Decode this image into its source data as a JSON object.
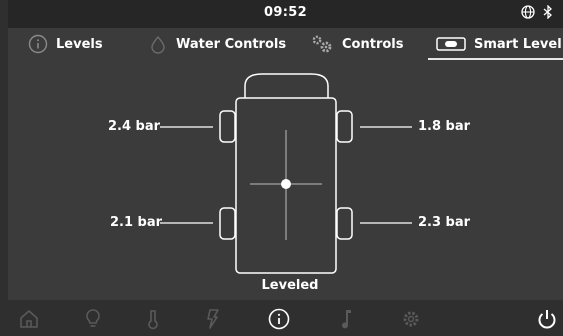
{
  "status": {
    "time": "09:52",
    "icons": [
      "globe-icon",
      "bluetooth-icon"
    ]
  },
  "tabs": [
    {
      "label": "Levels",
      "icon": "info-icon",
      "active": false
    },
    {
      "label": "Water Controls",
      "icon": "water-drop-icon",
      "active": false
    },
    {
      "label": "Controls",
      "icon": "gears-icon",
      "active": false
    },
    {
      "label": "Smart Level",
      "icon": "smart-level-icon",
      "active": true
    }
  ],
  "pressures": {
    "front_left": "2.4 bar",
    "front_right": "1.8 bar",
    "rear_left": "2.1 bar",
    "rear_right": "2.3 bar"
  },
  "level_status": "Leveled",
  "bottom_nav": [
    {
      "icon": "home-icon",
      "active": false
    },
    {
      "icon": "light-bulb-icon",
      "active": false
    },
    {
      "icon": "thermometer-icon",
      "active": false
    },
    {
      "icon": "lightning-icon",
      "active": false
    },
    {
      "icon": "info-icon",
      "active": true
    },
    {
      "icon": "music-note-icon",
      "active": false
    },
    {
      "icon": "settings-icon",
      "active": false
    },
    {
      "icon": "power-icon",
      "active": true
    }
  ],
  "colors": {
    "background": "#3b3b3b",
    "status_bar": "#262626",
    "bottom_bar": "#2f2f2f",
    "active": "#ffffff",
    "inactive_icon": "#5a5a5a"
  }
}
